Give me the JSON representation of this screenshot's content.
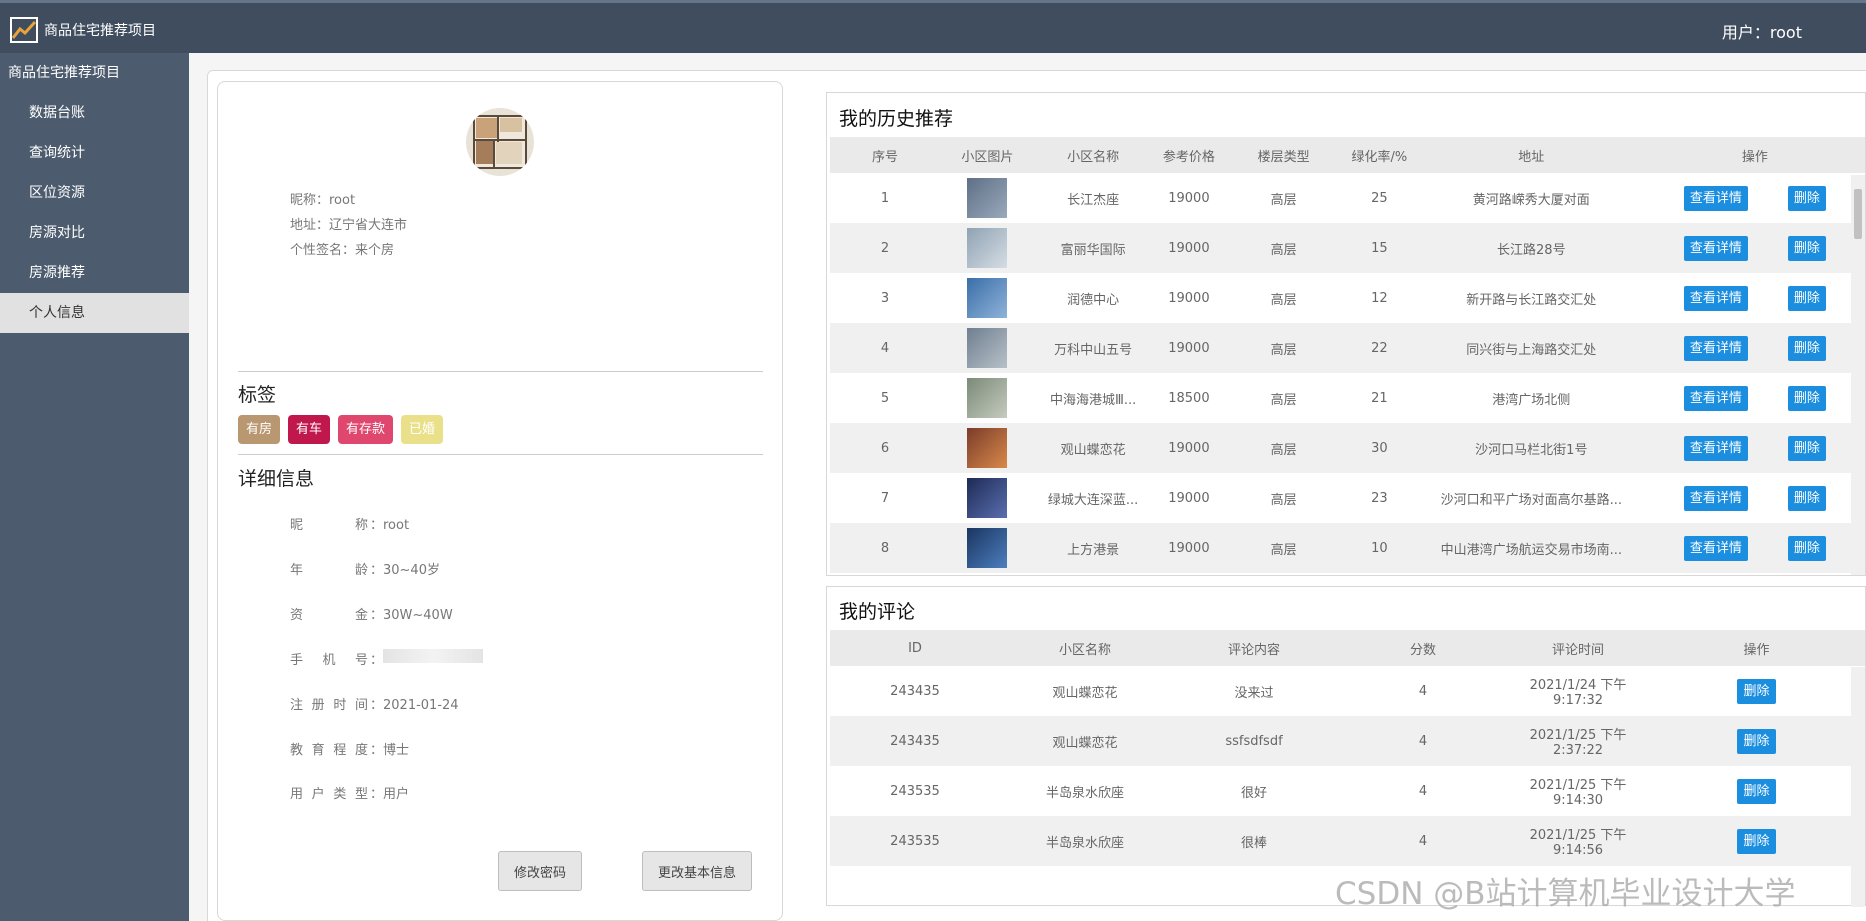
{
  "app": {
    "title": "商品住宅推荐项目",
    "user_label": "用户：root"
  },
  "sidebar": {
    "root": "商品住宅推荐项目",
    "items": [
      {
        "label": "数据台账"
      },
      {
        "label": "查询统计"
      },
      {
        "label": "区位资源"
      },
      {
        "label": "房源对比"
      },
      {
        "label": "房源推荐"
      },
      {
        "label": "个人信息"
      }
    ]
  },
  "profile": {
    "nickname": "昵称：root",
    "address": "地址：辽宁省大连市",
    "signature": "个性签名：来个房",
    "tags_title": "标签",
    "tags": [
      {
        "label": "有房",
        "color": "#b99770"
      },
      {
        "label": "有车",
        "color": "#c0184d"
      },
      {
        "label": "有存款",
        "color": "#e0476f"
      },
      {
        "label": "已婚",
        "color": "#ebe08a"
      }
    ],
    "detail_title": "详细信息",
    "details": [
      {
        "label": [
          "昵",
          "称"
        ],
        "value": "：root"
      },
      {
        "label": [
          "年",
          "龄"
        ],
        "value": "：30~40岁"
      },
      {
        "label": [
          "资",
          "金"
        ],
        "value": "：30W~40W"
      },
      {
        "label": [
          "手",
          "机",
          "号"
        ],
        "value": "："
      },
      {
        "label": [
          "注",
          "册",
          "时",
          "间"
        ],
        "value": "：2021-01-24"
      },
      {
        "label": [
          "教",
          "育",
          "程",
          "度"
        ],
        "value": "：博士"
      },
      {
        "label": [
          "用",
          "户",
          "类",
          "型"
        ],
        "value": "：用户"
      }
    ],
    "btn_change_pwd": "修改密码",
    "btn_change_info": "更改基本信息"
  },
  "history": {
    "title": "我的历史推荐",
    "columns": [
      "序号",
      "小区图片",
      "小区名称",
      "参考价格",
      "楼层类型",
      "绿化率/%",
      "地址",
      "操作"
    ],
    "detail_btn": "查看详情",
    "delete_btn": "删除",
    "rows": [
      {
        "no": "1",
        "name": "长江杰座",
        "price": "19000",
        "floor": "高层",
        "green": "25",
        "addr": "黄河路嵘秀大厦对面",
        "img": [
          "#5e6f86",
          "#9aa9bb"
        ]
      },
      {
        "no": "2",
        "name": "富丽华国际",
        "price": "19000",
        "floor": "高层",
        "green": "15",
        "addr": "长江路28号",
        "img": [
          "#8fa2b3",
          "#d5dde4"
        ]
      },
      {
        "no": "3",
        "name": "润德中心",
        "price": "19000",
        "floor": "高层",
        "green": "12",
        "addr": "新开路与长江路交汇处",
        "img": [
          "#3a6ea8",
          "#8fb3d9"
        ]
      },
      {
        "no": "4",
        "name": "万科中山五号",
        "price": "19000",
        "floor": "高层",
        "green": "22",
        "addr": "同兴街与上海路交汇处",
        "img": [
          "#6f7f8f",
          "#b7c0c8"
        ]
      },
      {
        "no": "5",
        "name": "中海海港城Ⅲ...",
        "price": "18500",
        "floor": "高层",
        "green": "21",
        "addr": "港湾广场北侧",
        "img": [
          "#7b8a78",
          "#c5cbbf"
        ]
      },
      {
        "no": "6",
        "name": "观山蝶恋花",
        "price": "19000",
        "floor": "高层",
        "green": "30",
        "addr": "沙河口马栏北街1号",
        "img": [
          "#7a3b2a",
          "#d98a4a"
        ]
      },
      {
        "no": "7",
        "name": "绿城大连深蓝...",
        "price": "19000",
        "floor": "高层",
        "green": "23",
        "addr": "沙河口和平广场对面高尔基路...",
        "img": [
          "#1d2a55",
          "#5a6fb0"
        ]
      },
      {
        "no": "8",
        "name": "上方港景",
        "price": "19000",
        "floor": "高层",
        "green": "10",
        "addr": "中山港湾广场航运交易市场南...",
        "img": [
          "#1a3560",
          "#4d7fbf"
        ]
      }
    ]
  },
  "comments": {
    "title": "我的评论",
    "columns": [
      "ID",
      "小区名称",
      "评论内容",
      "分数",
      "评论时间",
      "操作"
    ],
    "delete_btn": "删除",
    "rows": [
      {
        "id": "243435",
        "name": "观山蝶恋花",
        "content": "没来过",
        "score": "4",
        "time": "2021/1/24 下午9:17:32"
      },
      {
        "id": "243435",
        "name": "观山蝶恋花",
        "content": "ssfsdfsdf",
        "score": "4",
        "time": "2021/1/25 下午2:37:22"
      },
      {
        "id": "243535",
        "name": "半岛泉水欣座",
        "content": "很好",
        "score": "4",
        "time": "2021/1/25 下午9:14:30"
      },
      {
        "id": "243535",
        "name": "半岛泉水欣座",
        "content": "很棒",
        "score": "4",
        "time": "2021/1/25 下午9:14:56"
      }
    ]
  },
  "watermark": "CSDN @B站计算机毕业设计大学"
}
